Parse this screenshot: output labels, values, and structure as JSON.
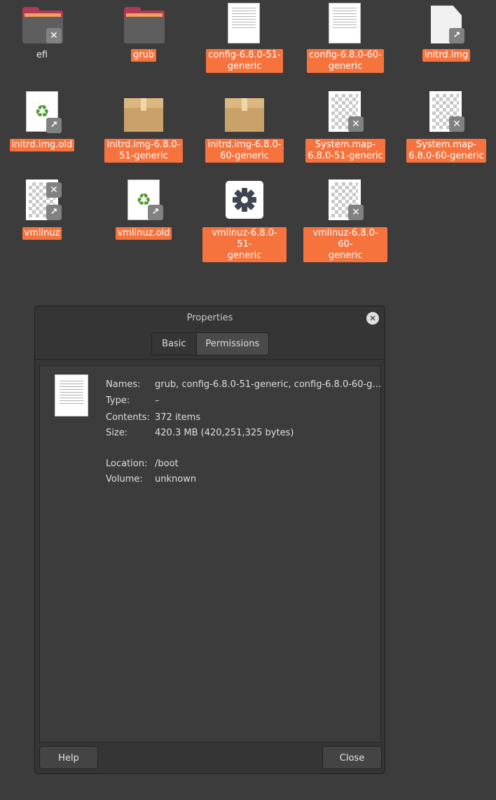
{
  "desktop": {
    "items": [
      {
        "label": "efi"
      },
      {
        "label": "grub"
      },
      {
        "label": "config-6.8.0-51-\ngeneric"
      },
      {
        "label": "config-6.8.0-60-\ngeneric"
      },
      {
        "label": "initrd.img"
      },
      {
        "label": "initrd.img.old"
      },
      {
        "label": "initrd.img-6.8.0-\n51-generic"
      },
      {
        "label": "initrd.img-6.8.0-\n60-generic"
      },
      {
        "label": "System.map-\n6.8.0-51-generic"
      },
      {
        "label": "System.map-\n6.8.0-60-generic"
      },
      {
        "label": "vmlinuz"
      },
      {
        "label": "vmlinuz.old"
      },
      {
        "label": "vmlinuz-6.8.0-51-\ngeneric"
      },
      {
        "label": "vmlinuz-6.8.0-60-\ngeneric"
      }
    ],
    "icons": {
      "folder": "folder-icon",
      "text": "text-file-icon",
      "file": "generic-file-icon",
      "recycle": "recycle-icon",
      "package": "package-icon",
      "checker": "image-file-icon",
      "gear": "gear-icon",
      "link_emblem": "symlink-emblem-icon",
      "broken_emblem": "broken-emblem-icon"
    },
    "colors": {
      "selection": "#f7733e",
      "background": "#3c3c3c"
    }
  },
  "dialog": {
    "title": "Properties",
    "close_glyph": "✕",
    "tabs": [
      "Basic",
      "Permissions"
    ],
    "active_tab": "Permissions",
    "fields": [
      {
        "key": "Names:",
        "value": "grub, config-6.8.0-51-generic, config-6.8.0-60-g…"
      },
      {
        "key": "Type:",
        "value": "–"
      },
      {
        "key": "Contents:",
        "value": "372 items"
      },
      {
        "key": "Size:",
        "value": "420.3 MB (420,251,325 bytes)"
      },
      {
        "key": "Location:",
        "value": "/boot"
      },
      {
        "key": "Volume:",
        "value": "unknown"
      }
    ],
    "buttons": {
      "help": "Help",
      "close": "Close"
    }
  }
}
